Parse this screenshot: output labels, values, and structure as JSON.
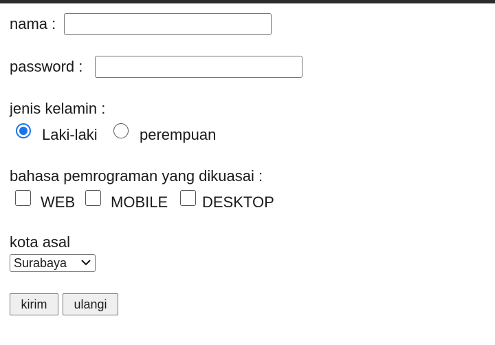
{
  "form": {
    "name_label": "nama :",
    "name_value": "",
    "password_label": "password :",
    "password_value": "",
    "gender": {
      "label": "jenis kelamin :",
      "options": [
        {
          "label": "Laki-laki",
          "checked": true
        },
        {
          "label": "perempuan",
          "checked": false
        }
      ]
    },
    "languages": {
      "label": "bahasa pemrograman yang dikuasai :",
      "options": [
        {
          "label": "WEB",
          "checked": false
        },
        {
          "label": "MOBILE",
          "checked": false
        },
        {
          "label": "DESKTOP",
          "checked": false
        }
      ]
    },
    "city": {
      "label": "kota asal",
      "selected": "Surabaya",
      "icon": "chevron-down-icon"
    },
    "buttons": {
      "submit": "kirim",
      "reset": "ulangi"
    }
  },
  "colors": {
    "accent": "#1a73e8",
    "top_bar": "#2b2b2b"
  }
}
